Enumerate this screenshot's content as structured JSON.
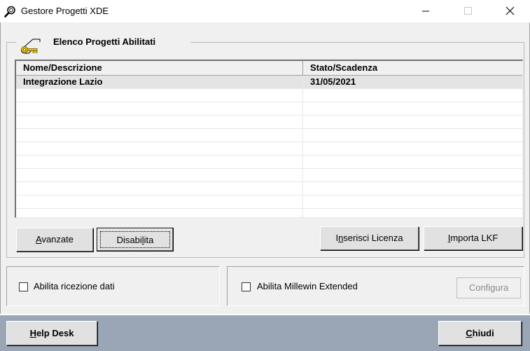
{
  "window": {
    "title": "Gestore Progetti XDE",
    "app_icon": "magnifier-icon",
    "controls": [
      "minimize-icon",
      "maximize-icon",
      "close-icon"
    ]
  },
  "projects_group": {
    "title": "Elenco Progetti Abilitati",
    "icon": "key-icon"
  },
  "list": {
    "columns": [
      "Nome/Descrizione",
      "Stato/Scadenza"
    ],
    "rows": [
      {
        "name": "Integrazione Lazio",
        "status": "31/05/2021",
        "selected": true
      }
    ]
  },
  "buttons": {
    "avanzate": {
      "before": "",
      "accel": "A",
      "after": "vanzate"
    },
    "disabilita": {
      "before": "Disabi",
      "accel": "l",
      "after": "ita"
    },
    "inserisci_licenza": {
      "before": "I",
      "accel": "n",
      "after": "serisci Licenza"
    },
    "importa_lkf": {
      "before": "",
      "accel": "I",
      "after": "mporta LKF"
    },
    "configura": "Configura",
    "help_desk": {
      "before": "",
      "accel": "H",
      "after": "elp Desk"
    },
    "chiudi": {
      "before": "",
      "accel": "C",
      "after": "hiudi"
    }
  },
  "options": {
    "ricezione_dati": {
      "label": "Abilita ricezione dati",
      "checked": false
    },
    "millewin_extended": {
      "label": "Abilita Millewin Extended",
      "checked": false
    }
  },
  "colors": {
    "bottom_bar": "#9aa6b6",
    "window_bg": "#f0f0f0",
    "selected_row": "#e4e4e4"
  }
}
